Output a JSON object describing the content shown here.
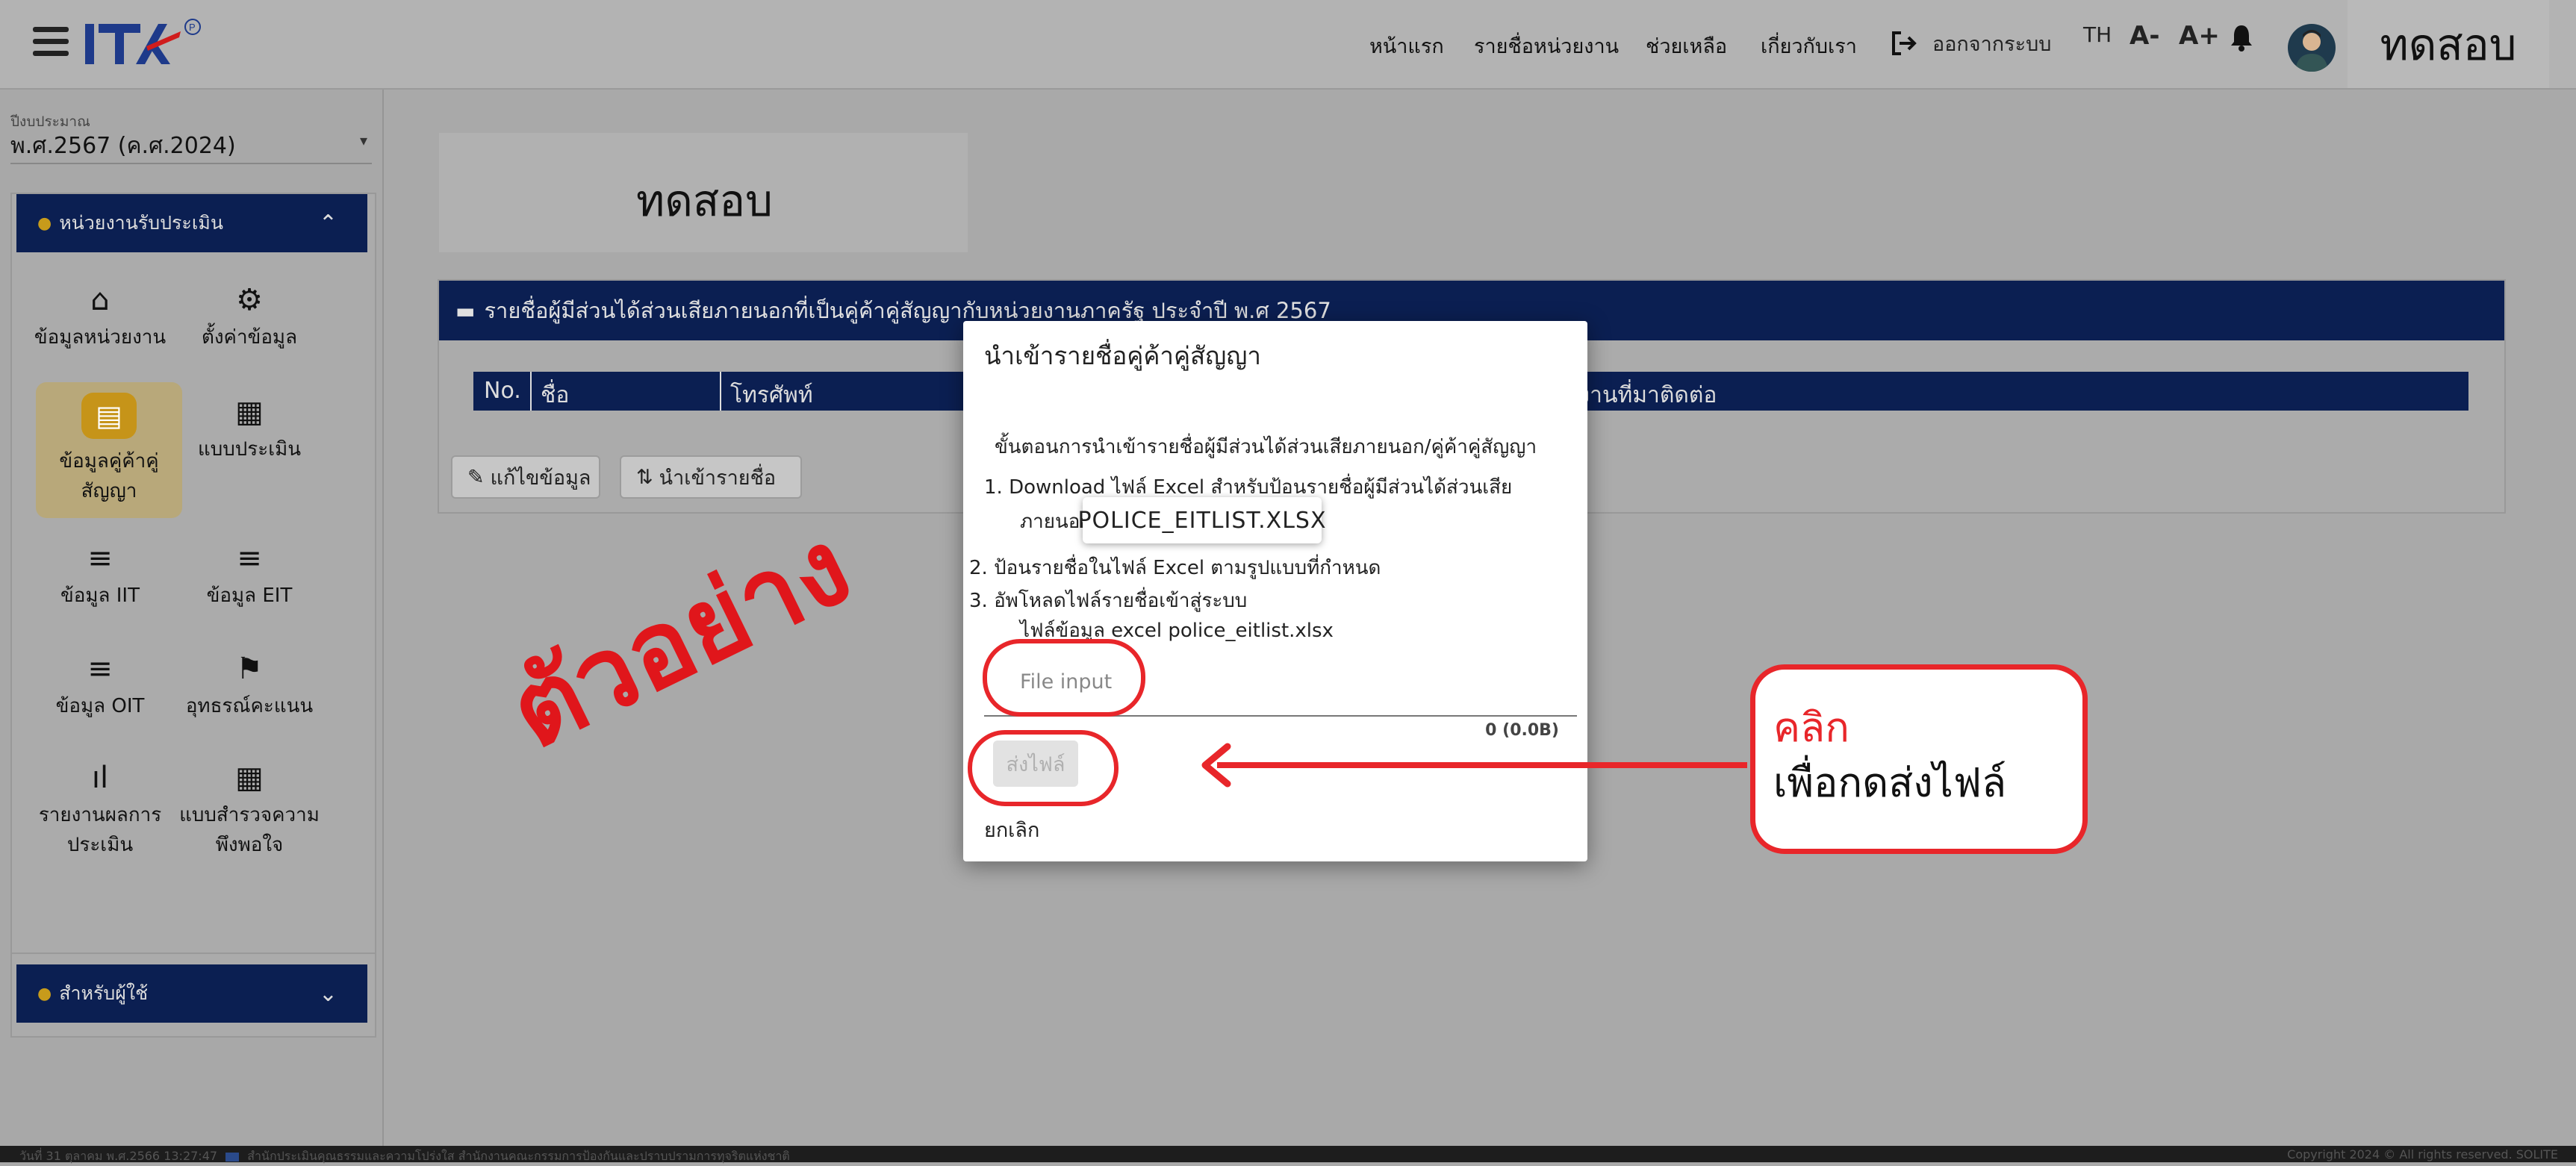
{
  "header": {
    "nav": [
      "หน้าแรก",
      "รายชื่อหน่วยงาน",
      "ช่วยเหลือ",
      "เกี่ยวกับเรา"
    ],
    "logout_label": "ออกจากระบบ",
    "lang": "TH",
    "font_decrease": "A-",
    "font_increase": "A+",
    "username": "ทดสอบ",
    "logo_text": "ITA"
  },
  "sidebar": {
    "fiscal_year_label": "ปีงบประมาณ",
    "fiscal_year_value": "พ.ศ.2567 (ค.ศ.2024)",
    "section1_title": "หน่วยงานรับประเมิน",
    "section2_title": "สำหรับผู้ใช้",
    "items": [
      {
        "label": "ข้อมูลหน่วยงาน",
        "icon": "home-icon"
      },
      {
        "label": "ตั้งค่าข้อมูล",
        "icon": "gear-icon"
      },
      {
        "label": "ข้อมูลคู่ค้าคู่สัญญา",
        "icon": "store-icon"
      },
      {
        "label": "แบบประเมิน",
        "icon": "qr-icon"
      },
      {
        "label": "ข้อมูล IIT",
        "icon": "checklist-icon"
      },
      {
        "label": "ข้อมูล EIT",
        "icon": "checklist-icon"
      },
      {
        "label": "ข้อมูล OIT",
        "icon": "checklist-icon"
      },
      {
        "label": "อุทธรณ์คะแนน",
        "icon": "flag-icon"
      },
      {
        "label": "รายงานผลการประเมิน",
        "icon": "bar-chart-icon"
      },
      {
        "label": "แบบสำรวจความพึงพอใจ",
        "icon": "qr-icon"
      }
    ]
  },
  "main": {
    "agency_name": "ทดสอบ",
    "panel_title": "รายชื่อผู้มีส่วนได้ส่วนเสียภายนอกที่เป็นคู่ค้าคู่สัญญากับหน่วยงานภาครัฐ ประจำปี พ.ศ 2567",
    "columns": [
      "No.",
      "ชื่อ",
      "โทรศัพท์",
      "นงานที่มาติดต่อ"
    ],
    "edit_label": "แก้ไขข้อมูล",
    "import_label": "นำเข้ารายชื่อ",
    "watermark": "ตัวอย่าง"
  },
  "dialog": {
    "title": "นำเข้ารายชื่อคู่ค้าคู่สัญญา",
    "steps_heading": "ขั้นตอนการนำเข้ารายชื่อผู้มีส่วนได้ส่วนเสียภายนอก/คู่ค้าคู่สัญญา",
    "step1": "1.  Download ไฟล์ Excel สำหรับป้อนรายชื่อผู้มีส่วนได้ส่วนเสีย",
    "step1_cont": "ภายนอก",
    "step2": "2. ป้อนรายชื่อในไฟล์ Excel ตามรูปแบบที่กำหนด",
    "step3": "3. อัพโหลดไฟล์รายชื่อเข้าสู่ระบบ",
    "file_note": "ไฟล์ข้อมูล excel police_eitlist.xlsx",
    "tooltip": "POLICE_EITLIST.XLSX",
    "file_input_placeholder": "File input",
    "file_size": "0 (0.0B)",
    "send_label": "ส่งไฟล์",
    "cancel_label": "ยกเลิก"
  },
  "annotation": {
    "callout_line1": "คลิก",
    "callout_line2": "เพื่อกดส่งไฟล์"
  },
  "footer": {
    "left": "วันที่ 31 ตุลาคม พ.ศ.2566 13:27:47",
    "left2": "สำนักประเมินคุณธรรมและความโปร่งใส สำนักงานคณะกรรมการป้องกันและปราบปรามการทุจริตแห่งชาติ",
    "right": "Copyright 2024 © All rights reserved.    SOLITE"
  },
  "colors": {
    "navy": "#0b1f52",
    "accent_gold": "#c69419",
    "annotation_red": "#e8262a"
  }
}
